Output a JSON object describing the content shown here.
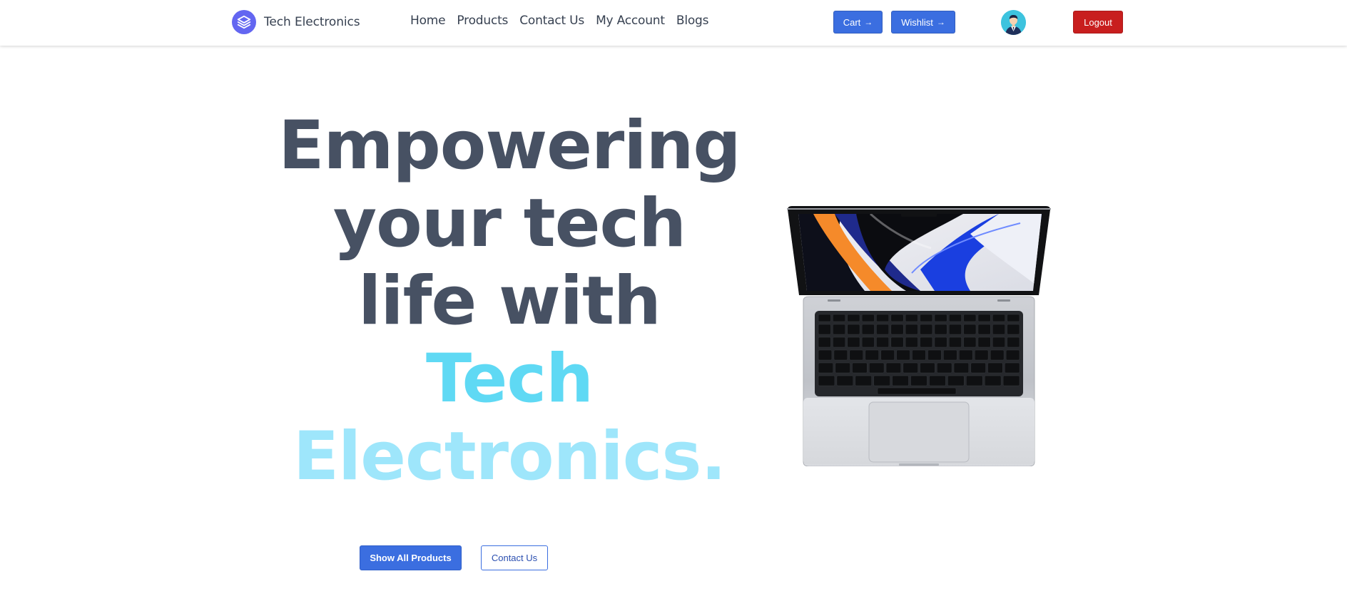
{
  "header": {
    "brand_name": "Tech Electronics",
    "nav": [
      "Home",
      "Products",
      "Contact Us",
      "My Account",
      "Blogs"
    ],
    "cart_label": "Cart",
    "wishlist_label": "Wishlist",
    "logout_label": "Logout",
    "arrow_glyph": "→"
  },
  "hero": {
    "line1": "Empowering",
    "line2": "your tech",
    "line3": "life with",
    "accent_line1": "Tech",
    "accent_line2": "Electronics.",
    "primary_cta": "Show All Products",
    "secondary_cta": "Contact Us"
  },
  "colors": {
    "brand": "#6366f1",
    "primary_button": "#3b6ee0",
    "logout_button": "#c81e1e",
    "heading_dark": "#475163",
    "heading_accent": "#5fd9f4",
    "heading_accent_light": "#9ee6fb"
  },
  "icons": {
    "brand_logo": "stacked-layers-icon",
    "avatar": "user-avatar-icon",
    "hero_image": "laptop-illustration"
  }
}
